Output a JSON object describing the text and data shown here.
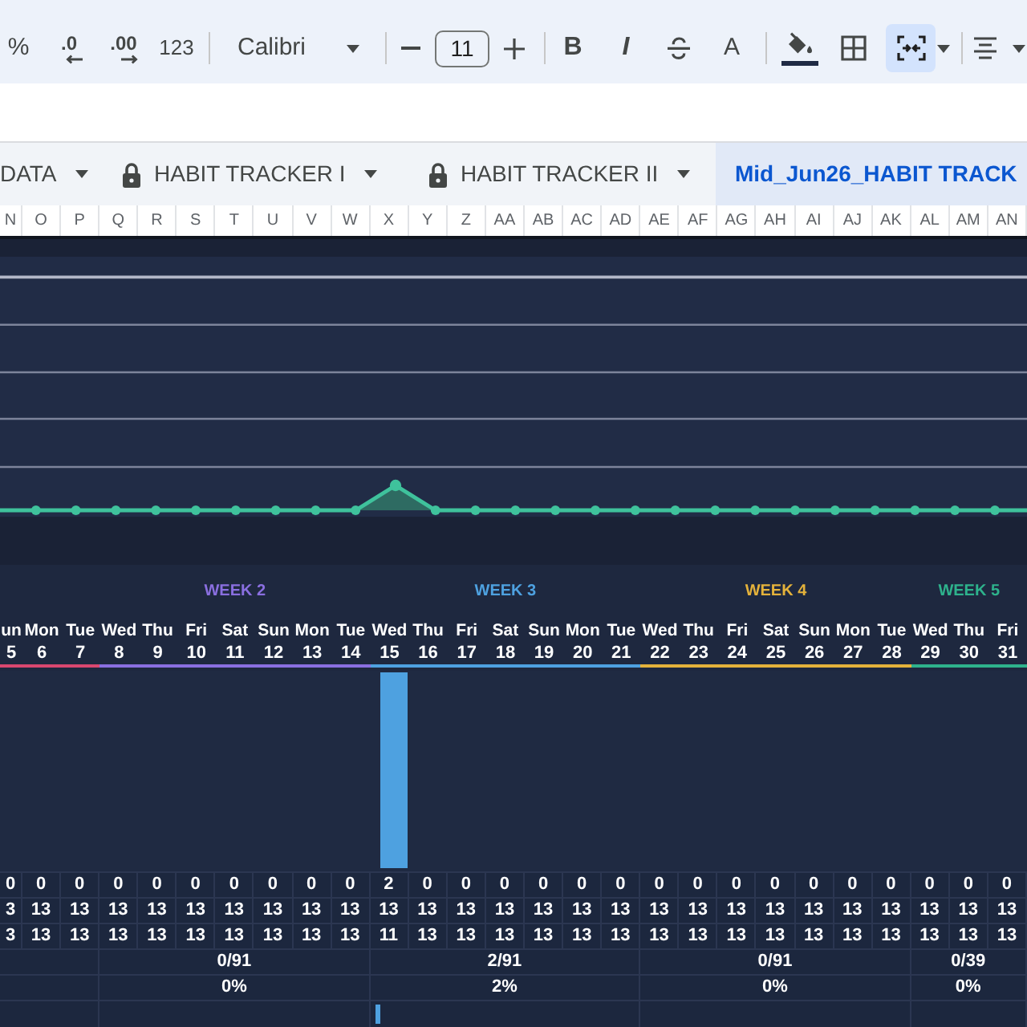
{
  "toolbar": {
    "groups": [
      [
        {
          "kind": "percent",
          "label": "%",
          "on": false
        },
        {
          "kind": "decrease_decimals",
          "label": ".0",
          "on": false
        },
        {
          "kind": "increase_decimals",
          "label": ".00",
          "on": false
        },
        {
          "kind": "number_format",
          "label": "123",
          "on": false
        }
      ],
      [
        {
          "kind": "font",
          "label": "Calibri",
          "on": false
        }
      ],
      [
        {
          "kind": "decrease_size",
          "on": false
        },
        {
          "kind": "font_size",
          "value": "11",
          "on": false
        },
        {
          "kind": "increase_size",
          "on": false
        }
      ],
      [
        {
          "kind": "bold",
          "label": "B",
          "on": false
        },
        {
          "kind": "italic",
          "label": "I",
          "on": false
        },
        {
          "kind": "strikethrough",
          "on": false
        },
        {
          "kind": "text_color",
          "label": "A",
          "on": false
        }
      ],
      [
        {
          "kind": "fill_color",
          "color": "#1f2a44",
          "on": false
        },
        {
          "kind": "borders",
          "on": false
        },
        {
          "kind": "merge",
          "on": true
        }
      ],
      [
        {
          "kind": "align",
          "on": false
        }
      ]
    ]
  },
  "sheet_tabs": [
    {
      "label": "DATA",
      "locked": false,
      "dropdown": true,
      "selected": false
    },
    {
      "label": "HABIT TRACKER I",
      "locked": true,
      "dropdown": true,
      "selected": false
    },
    {
      "label": "HABIT TRACKER II",
      "locked": true,
      "dropdown": true,
      "selected": false
    },
    {
      "label": "Mid_Jun26_HABIT TRACK",
      "locked": false,
      "dropdown": false,
      "selected": true
    }
  ],
  "column_headers": [
    "N",
    "O",
    "P",
    "Q",
    "R",
    "S",
    "T",
    "U",
    "V",
    "W",
    "X",
    "Y",
    "Z",
    "AA",
    "AB",
    "AC",
    "AD",
    "AE",
    "AF",
    "AG",
    "AH",
    "AI",
    "AJ",
    "AK",
    "AL",
    "AM",
    "AN"
  ],
  "weeks": [
    {
      "color": "#d9476f",
      "days": [
        {
          "day": "un",
          "date": "5",
          "values": [
            "0",
            "3",
            "3"
          ]
        },
        {
          "day": "Mon",
          "date": "6",
          "values": [
            "0",
            "13",
            "13"
          ]
        },
        {
          "day": "Tue",
          "date": "7",
          "values": [
            "0",
            "13",
            "13"
          ]
        }
      ]
    },
    {
      "label": "WEEK 2",
      "color": "#8a6fe0",
      "days": [
        {
          "day": "Wed",
          "date": "8",
          "values": [
            "0",
            "13",
            "13"
          ]
        },
        {
          "day": "Thu",
          "date": "9",
          "values": [
            "0",
            "13",
            "13"
          ]
        },
        {
          "day": "Fri",
          "date": "10",
          "values": [
            "0",
            "13",
            "13"
          ]
        },
        {
          "day": "Sat",
          "date": "11",
          "values": [
            "0",
            "13",
            "13"
          ]
        },
        {
          "day": "Sun",
          "date": "12",
          "values": [
            "0",
            "13",
            "13"
          ]
        },
        {
          "day": "Mon",
          "date": "13",
          "values": [
            "0",
            "13",
            "13"
          ]
        },
        {
          "day": "Tue",
          "date": "14",
          "values": [
            "0",
            "13",
            "13"
          ]
        }
      ],
      "score": "0/91",
      "percent": "0%"
    },
    {
      "label": "WEEK 3",
      "color": "#4ea1e0",
      "days": [
        {
          "day": "Wed",
          "date": "15",
          "values": [
            "2",
            "13",
            "11"
          ]
        },
        {
          "day": "Thu",
          "date": "16",
          "values": [
            "0",
            "13",
            "13"
          ]
        },
        {
          "day": "Fri",
          "date": "17",
          "values": [
            "0",
            "13",
            "13"
          ]
        },
        {
          "day": "Sat",
          "date": "18",
          "values": [
            "0",
            "13",
            "13"
          ]
        },
        {
          "day": "Sun",
          "date": "19",
          "values": [
            "0",
            "13",
            "13"
          ]
        },
        {
          "day": "Mon",
          "date": "20",
          "values": [
            "0",
            "13",
            "13"
          ]
        },
        {
          "day": "Tue",
          "date": "21",
          "values": [
            "0",
            "13",
            "13"
          ]
        }
      ],
      "score": "2/91",
      "percent": "2%",
      "level": 0.02
    },
    {
      "label": "WEEK 4",
      "color": "#e4b23b",
      "days": [
        {
          "day": "Wed",
          "date": "22",
          "values": [
            "0",
            "13",
            "13"
          ]
        },
        {
          "day": "Thu",
          "date": "23",
          "values": [
            "0",
            "13",
            "13"
          ]
        },
        {
          "day": "Fri",
          "date": "24",
          "values": [
            "0",
            "13",
            "13"
          ]
        },
        {
          "day": "Sat",
          "date": "25",
          "values": [
            "0",
            "13",
            "13"
          ]
        },
        {
          "day": "Sun",
          "date": "26",
          "values": [
            "0",
            "13",
            "13"
          ]
        },
        {
          "day": "Mon",
          "date": "27",
          "values": [
            "0",
            "13",
            "13"
          ]
        },
        {
          "day": "Tue",
          "date": "28",
          "values": [
            "0",
            "13",
            "13"
          ]
        }
      ],
      "score": "0/91",
      "percent": "0%"
    },
    {
      "label": "WEEK 5",
      "color": "#2eb28c",
      "days": [
        {
          "day": "Wed",
          "date": "29",
          "values": [
            "0",
            "13",
            "13"
          ]
        },
        {
          "day": "Thu",
          "date": "30",
          "values": [
            "0",
            "13",
            "13"
          ]
        },
        {
          "day": "Fri",
          "date": "31",
          "values": [
            "0",
            "13",
            "13"
          ]
        }
      ],
      "score": "0/39",
      "percent": "0%"
    }
  ]
}
